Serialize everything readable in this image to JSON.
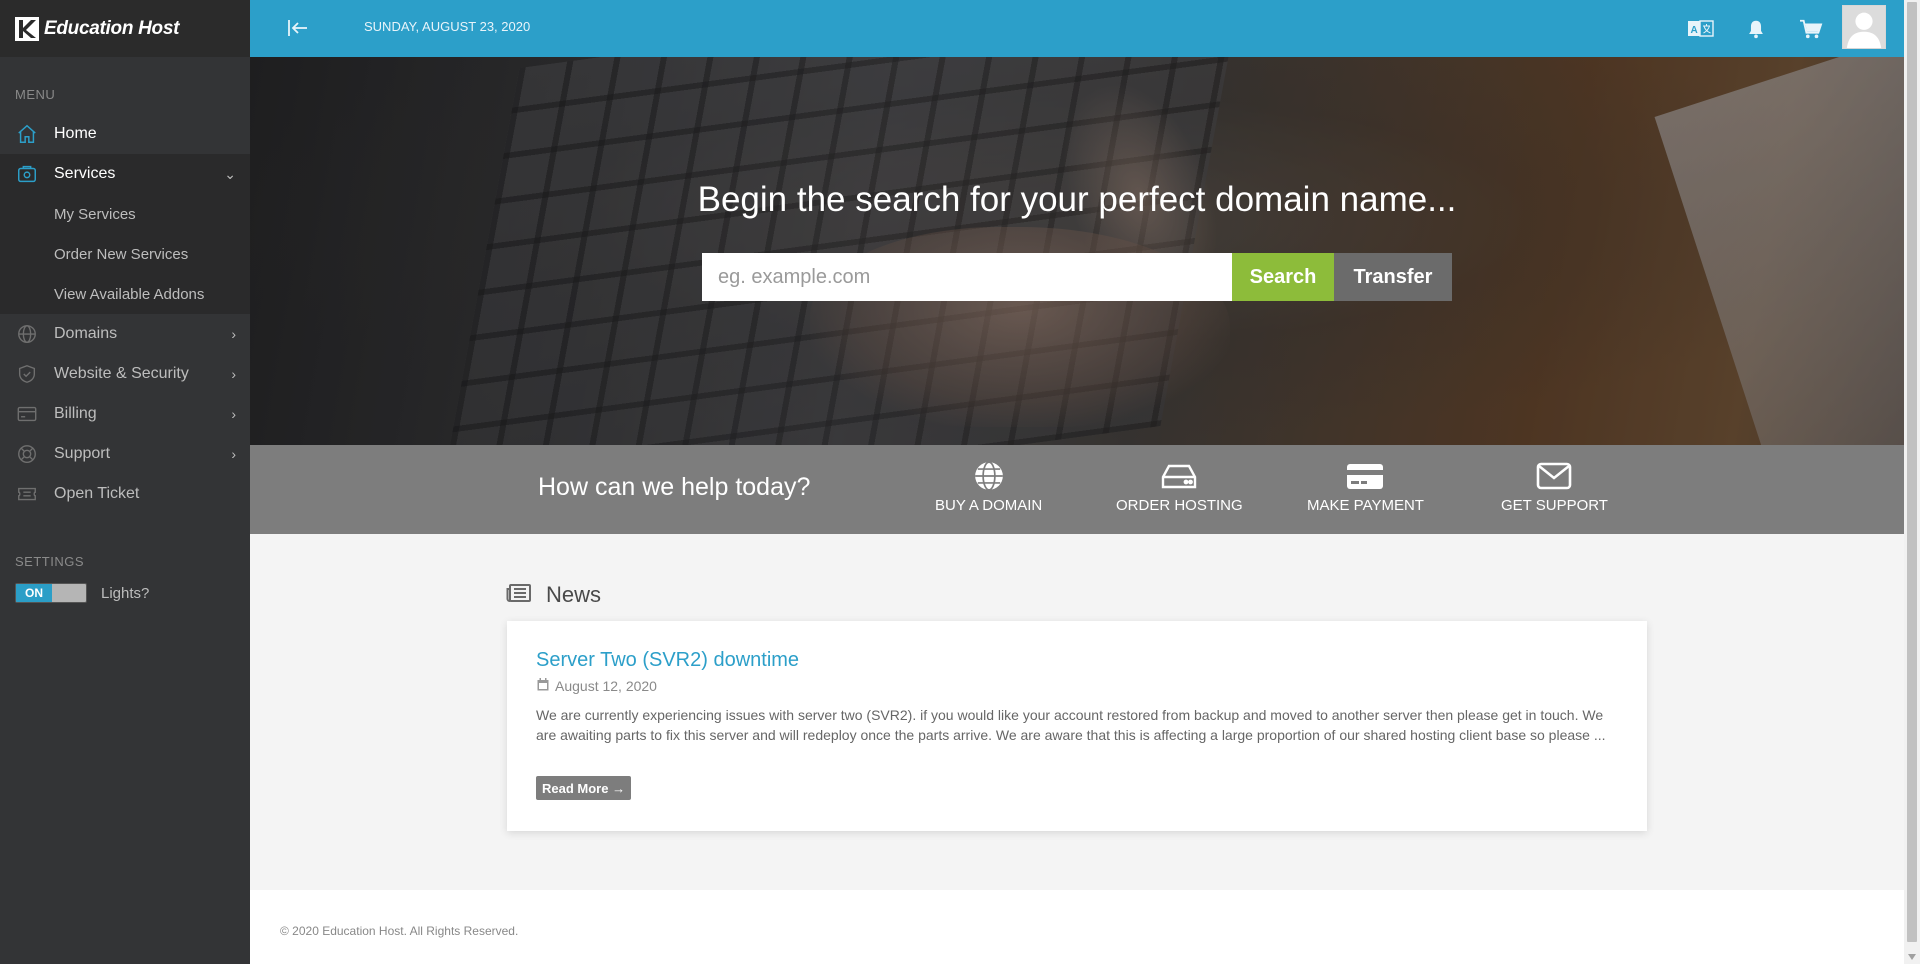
{
  "brand": {
    "name": "Education Host"
  },
  "topbar": {
    "date": "SUNDAY, AUGUST 23, 2020"
  },
  "sidebar": {
    "menu_label": "MENU",
    "items": [
      {
        "label": "Home",
        "icon": "home-icon"
      },
      {
        "label": "Services",
        "icon": "services-icon",
        "expanded": true,
        "children": [
          {
            "label": "My Services"
          },
          {
            "label": "Order New Services"
          },
          {
            "label": "View Available Addons"
          }
        ]
      },
      {
        "label": "Domains",
        "icon": "globe-icon"
      },
      {
        "label": "Website & Security",
        "icon": "shield-icon"
      },
      {
        "label": "Billing",
        "icon": "credit-card-icon"
      },
      {
        "label": "Support",
        "icon": "lifebuoy-icon"
      },
      {
        "label": "Open Ticket",
        "icon": "ticket-icon"
      }
    ],
    "settings_label": "SETTINGS",
    "lights": {
      "toggle_state": "ON",
      "label": "Lights?"
    }
  },
  "hero": {
    "title": "Begin the search for your perfect domain name...",
    "search_placeholder": "eg. example.com",
    "search_label": "Search",
    "transfer_label": "Transfer"
  },
  "help": {
    "title": "How can we help today?",
    "links": [
      {
        "label": "BUY A DOMAIN",
        "icon": "globe-icon"
      },
      {
        "label": "ORDER HOSTING",
        "icon": "server-icon"
      },
      {
        "label": "MAKE PAYMENT",
        "icon": "credit-card-icon"
      },
      {
        "label": "GET SUPPORT",
        "icon": "envelope-icon"
      }
    ]
  },
  "news": {
    "heading": "News",
    "items": [
      {
        "title": "Server Two (SVR2) downtime",
        "date": "August 12, 2020",
        "excerpt": "We are currently experiencing issues with server two (SVR2). if you would like your account restored from backup and moved to another server then please get in touch. We are awaiting parts to fix this server and will redeploy once the parts arrive. We are aware that this is affecting a large proportion of our shared hosting client base so please ...",
        "read_more": "Read More →"
      }
    ]
  },
  "footer": {
    "copyright": "© 2020 Education Host. All Rights Reserved."
  },
  "colors": {
    "accent": "#2c9fc9",
    "sidebar_bg": "#333436",
    "search_green": "#8dbc3a",
    "help_strip": "#7d7d7d"
  }
}
